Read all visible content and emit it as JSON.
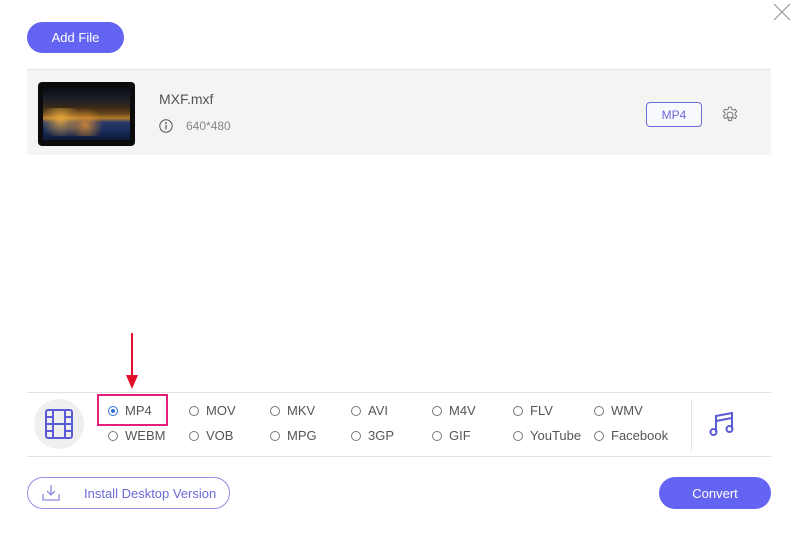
{
  "header": {
    "add_file_label": "Add File",
    "close_icon": "close-icon"
  },
  "file": {
    "name": "MXF.mxf",
    "resolution": "640*480",
    "thumbnail": "video-thumbnail-night-harbor",
    "output_format": "MP4",
    "info_icon": "info-icon",
    "settings_icon": "gear-icon"
  },
  "formats": {
    "selected": "MP4",
    "video_tab_icon": "film-icon",
    "audio_tab_icon": "music-note-icon",
    "row1": [
      "MP4",
      "MOV",
      "MKV",
      "AVI",
      "M4V",
      "FLV",
      "WMV"
    ],
    "row2": [
      "WEBM",
      "VOB",
      "MPG",
      "3GP",
      "GIF",
      "YouTube",
      "Facebook"
    ]
  },
  "annotation": {
    "arrow_color": "#e0102a",
    "highlight_color": "#e0207a"
  },
  "footer": {
    "install_label": "Install Desktop Version",
    "convert_label": "Convert"
  },
  "colors": {
    "accent": "#6464f2",
    "radio_selected": "#2f6fe0"
  }
}
